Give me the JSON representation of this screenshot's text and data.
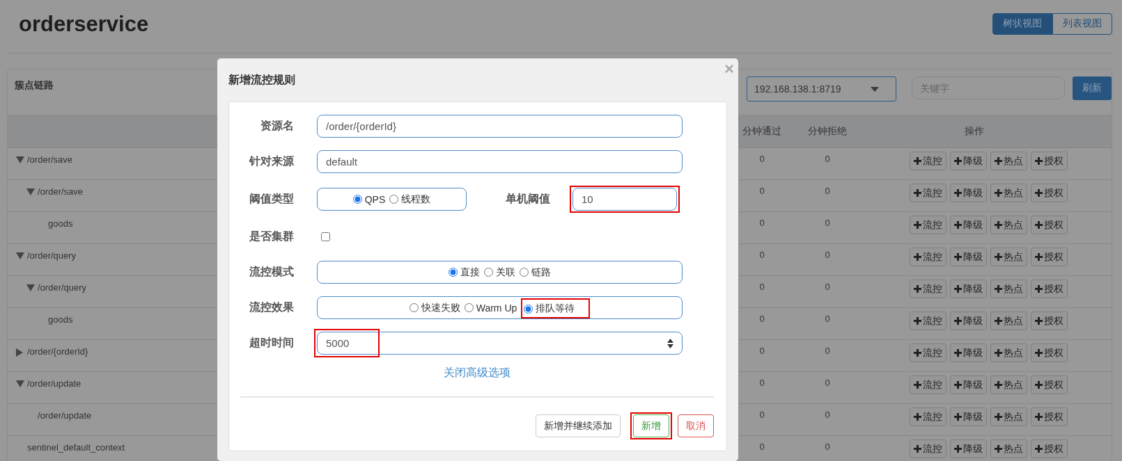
{
  "page": {
    "title": "orderservice",
    "view_toggle": [
      {
        "label": "树状视图",
        "selected": true
      },
      {
        "label": "列表视图",
        "selected": false
      }
    ]
  },
  "panel": {
    "title": "簇点链路",
    "machine_select": {
      "value": "192.168.138.1:8719"
    },
    "search": {
      "placeholder": "关键字"
    },
    "refresh_button": "刷新"
  },
  "table": {
    "columns": [
      "分钟通过",
      "分钟拒绝",
      "操作"
    ],
    "rows": [
      {
        "resource": "/order/save",
        "expanded": true,
        "pass": "0",
        "reject": "0",
        "actions": [
          "流控",
          "降级",
          "热点",
          "授权"
        ],
        "children": [
          {
            "resource": "/order/save",
            "expanded": true,
            "pass": "0",
            "reject": "0",
            "actions": [
              "流控",
              "降级",
              "热点",
              "授权"
            ],
            "children": [
              {
                "resource": "goods",
                "pass": "0",
                "reject": "0",
                "actions": [
                  "流控",
                  "降级",
                  "热点",
                  "授权"
                ]
              }
            ]
          }
        ]
      },
      {
        "resource": "/order/query",
        "expanded": true,
        "pass": "0",
        "reject": "0",
        "actions": [
          "流控",
          "降级",
          "热点",
          "授权"
        ],
        "children": [
          {
            "resource": "/order/query",
            "expanded": true,
            "pass": "0",
            "reject": "0",
            "actions": [
              "流控",
              "降级",
              "热点",
              "授权"
            ],
            "children": [
              {
                "resource": "goods",
                "pass": "0",
                "reject": "0",
                "actions": [
                  "流控",
                  "降级",
                  "热点",
                  "授权"
                ]
              }
            ]
          }
        ]
      },
      {
        "resource": "/order/{orderId}",
        "expanded": false,
        "pass": "0",
        "reject": "0",
        "actions": [
          "流控",
          "降级",
          "热点",
          "授权"
        ]
      },
      {
        "resource": "/order/update",
        "expanded": true,
        "pass": "0",
        "reject": "0",
        "actions": [
          "流控",
          "降级",
          "热点",
          "授权"
        ],
        "children": [
          {
            "resource": "/order/update",
            "pass": "0",
            "reject": "0",
            "actions": [
              "流控",
              "降级",
              "热点",
              "授权"
            ]
          }
        ]
      },
      {
        "resource": "sentinel_default_context",
        "pass": "0",
        "reject": "0",
        "actions": [
          "流控",
          "降级",
          "热点",
          "授权"
        ]
      }
    ]
  },
  "dialog": {
    "title": "新增流控规则",
    "close": "×",
    "fields": [
      {
        "kind": "text",
        "label": "资源名",
        "value": "/order/{orderId}"
      },
      {
        "kind": "text",
        "label": "针对来源",
        "value": "default"
      },
      {
        "kind": "threshold",
        "label": "阈值类型",
        "options": [
          {
            "label": "QPS",
            "selected": true,
            "highlighted": false
          },
          {
            "label": "线程数",
            "selected": false,
            "highlighted": false
          }
        ],
        "side_label": "单机阈值",
        "side_value": "10",
        "side_highlighted": true
      },
      {
        "kind": "checkbox",
        "label": "是否集群",
        "checked": false
      },
      {
        "kind": "radio",
        "label": "流控模式",
        "options": [
          {
            "label": "直接",
            "selected": true,
            "highlighted": false
          },
          {
            "label": "关联",
            "selected": false,
            "highlighted": false
          },
          {
            "label": "链路",
            "selected": false,
            "highlighted": false
          }
        ]
      },
      {
        "kind": "radio",
        "label": "流控效果",
        "options": [
          {
            "label": "快速失败",
            "selected": false,
            "highlighted": false
          },
          {
            "label": "Warm Up",
            "selected": false,
            "highlighted": false
          },
          {
            "label": "排队等待",
            "selected": true,
            "highlighted": true
          }
        ]
      },
      {
        "kind": "number",
        "label": "超时时间",
        "value": "5000",
        "highlighted": true
      }
    ],
    "advanced_link": "关闭高级选项",
    "buttons": [
      {
        "label": "新增并继续添加",
        "kind": "default",
        "highlighted": false
      },
      {
        "label": "新增",
        "kind": "success",
        "highlighted": true
      },
      {
        "label": "取消",
        "kind": "danger",
        "highlighted": false
      }
    ]
  }
}
